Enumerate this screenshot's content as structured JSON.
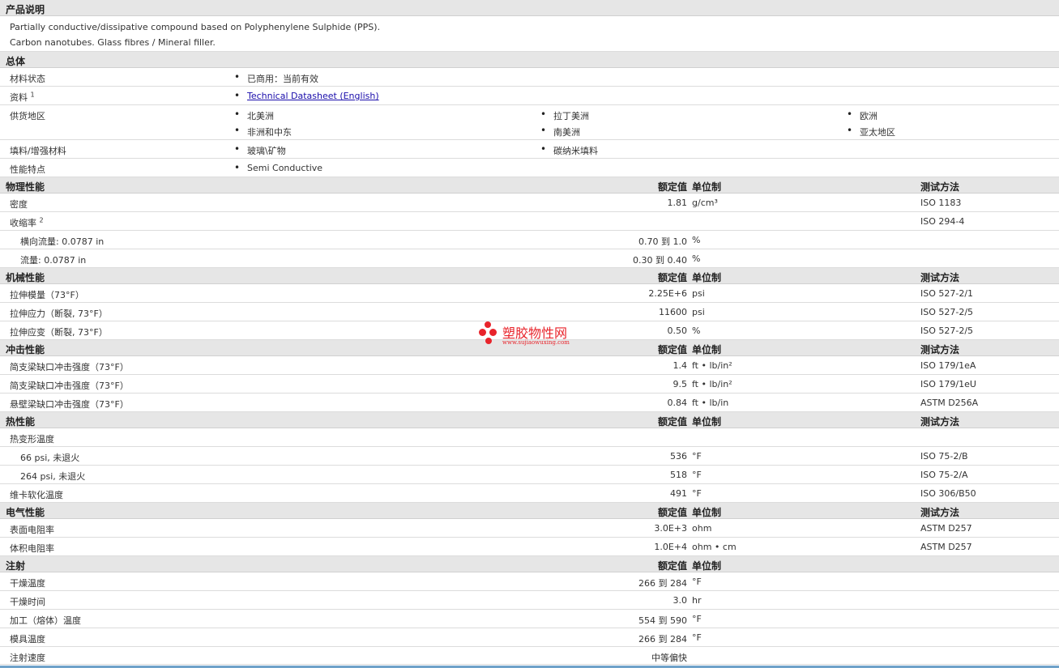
{
  "desc": {
    "title": "产品说明",
    "line1": "Partially conductive/dissipative compound based on Polyphenylene Sulphide (PPS).",
    "line2": "Carbon nanotubes. Glass fibres / Mineral filler."
  },
  "general": {
    "title": "总体",
    "status_label": "材料状态",
    "status_value": "已商用：当前有效",
    "docs_label": "资料",
    "docs_sup": "1",
    "docs_link": "Technical Datasheet (English)",
    "region_label": "供货地区",
    "regions": [
      "北美洲",
      "拉丁美洲",
      "欧洲",
      "非洲和中东",
      "南美洲",
      "亚太地区"
    ],
    "filler_label": "填料/增强材料",
    "fillers": [
      "玻璃\\矿物",
      "碳纳米填料"
    ],
    "feature_label": "性能特点",
    "feature_value": "Semi Conductive"
  },
  "headers": {
    "value": "额定值",
    "unit": "单位制",
    "test": "测试方法"
  },
  "physical": {
    "title": "物理性能",
    "density_label": "密度",
    "density_val": "1.81",
    "density_unit": "g/cm³",
    "density_test": "ISO 1183",
    "shrink_label": "收缩率",
    "shrink_sup": "2",
    "shrink_test": "ISO 294-4",
    "shrink_t_label": "横向流量: 0.0787 in",
    "shrink_t_val": "0.70 到  1.0",
    "shrink_t_unit": "%",
    "shrink_f_label": "流量: 0.0787 in",
    "shrink_f_val": "0.30 到  0.40",
    "shrink_f_unit": "%"
  },
  "mechanical": {
    "title": "机械性能",
    "rows": [
      {
        "label": "拉伸模量（73°F）",
        "val": "2.25E+6",
        "unit": "psi",
        "test": "ISO 527-2/1"
      },
      {
        "label": "拉伸应力（断裂, 73°F）",
        "val": "11600",
        "unit": "psi",
        "test": "ISO 527-2/5"
      },
      {
        "label": "拉伸应变（断裂, 73°F）",
        "val": "0.50",
        "unit": "%",
        "test": "ISO 527-2/5"
      }
    ]
  },
  "impact": {
    "title": "冲击性能",
    "rows": [
      {
        "label": "简支梁缺口冲击强度（73°F）",
        "val": "1.4",
        "unit": "ft • lb/in²",
        "test": "ISO 179/1eA"
      },
      {
        "label": "简支梁缺口冲击强度（73°F）",
        "val": "9.5",
        "unit": "ft • lb/in²",
        "test": "ISO 179/1eU"
      },
      {
        "label": "悬壁梁缺口冲击强度（73°F）",
        "val": "0.84",
        "unit": "ft • lb/in",
        "test": "ASTM D256A"
      }
    ]
  },
  "thermal": {
    "title": "热性能",
    "hdt_label": "热变形温度",
    "hdt1_label": "66 psi, 未退火",
    "hdt1_val": "536",
    "hdt1_unit": "°F",
    "hdt1_test": "ISO 75-2/B",
    "hdt2_label": "264 psi, 未退火",
    "hdt2_val": "518",
    "hdt2_unit": "°F",
    "hdt2_test": "ISO 75-2/A",
    "vicat_label": "维卡软化温度",
    "vicat_val": "491",
    "vicat_unit": "°F",
    "vicat_test": "ISO 306/B50"
  },
  "electrical": {
    "title": "电气性能",
    "rows": [
      {
        "label": "表面电阻率",
        "val": "3.0E+3",
        "unit": "ohm",
        "test": "ASTM D257"
      },
      {
        "label": "体积电阻率",
        "val": "1.0E+4",
        "unit": "ohm • cm",
        "test": "ASTM D257"
      }
    ]
  },
  "injection": {
    "title": "注射",
    "rows": [
      {
        "label": "干燥温度",
        "val": "266 到  284",
        "unit": "°F"
      },
      {
        "label": "干燥时间",
        "val": "3.0",
        "unit": "hr"
      },
      {
        "label": "加工（熔体）温度",
        "val": "554 到  590",
        "unit": "°F"
      },
      {
        "label": "模具温度",
        "val": "266 到  284",
        "unit": "°F"
      },
      {
        "label": "注射速度",
        "val": "中等偏快",
        "unit": ""
      }
    ]
  },
  "watermark": {
    "text": "塑胶物性网",
    "url": "www.sujiaowuxing.com",
    "color": "#e8242b"
  }
}
